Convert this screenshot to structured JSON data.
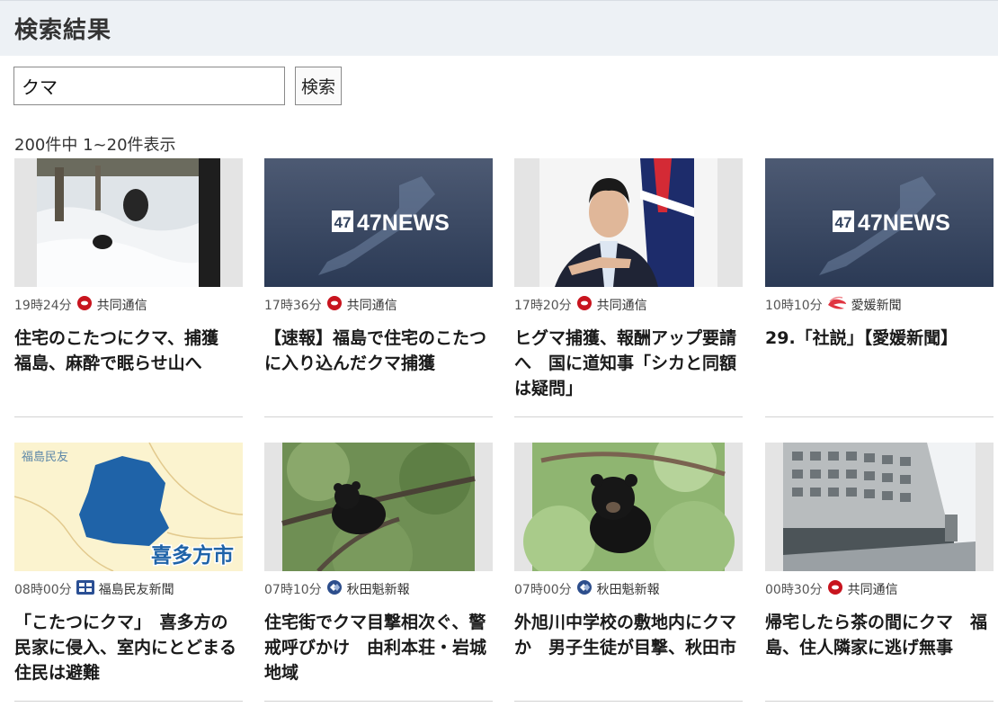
{
  "header": {
    "title": "検索結果"
  },
  "search": {
    "value": "クマ",
    "button_label": "検索"
  },
  "results_count": "200件中 1~20件表示",
  "articles": [
    {
      "time": "19時24分",
      "source": "共同通信",
      "logo": "kyodo-logo",
      "title": "住宅のこたつにクマ、捕獲　福島、麻酔で眠らせ山へ",
      "image": "bear-in-snow"
    },
    {
      "time": "17時36分",
      "source": "共同通信",
      "logo": "kyodo-logo",
      "title": "【速報】福島で住宅のこたつに入り込んだクマ捕獲",
      "image": "47news-placeholder",
      "image_text": "47NEWS"
    },
    {
      "time": "17時20分",
      "source": "共同通信",
      "logo": "kyodo-logo",
      "title": "ヒグマ捕獲、報酬アップ要請へ　国に道知事「シカと同額は疑問」",
      "image": "governor-speaking"
    },
    {
      "time": "10時10分",
      "source": "愛媛新聞",
      "logo": "ehime-logo",
      "title": "29.「社説」【愛媛新聞】",
      "image": "47news-placeholder",
      "image_text": "47NEWS"
    },
    {
      "time": "08時00分",
      "source": "福島民友新聞",
      "logo": "minyu-logo",
      "title": "「こたつにクマ」　喜多方の民家に侵入、室内にとどまる　住民は避難",
      "image": "map-kitakata",
      "image_text": "喜多方市",
      "image_corner_text": "福島民友"
    },
    {
      "time": "07時10分",
      "source": "秋田魁新報",
      "logo": "sakigake-logo",
      "title": "住宅街でクマ目撃相次ぐ、警戒呼びかけ　由利本荘・岩城地域",
      "image": "bear-in-tree"
    },
    {
      "time": "07時00分",
      "source": "秋田魁新報",
      "logo": "sakigake-logo",
      "title": "外旭川中学校の敷地内にクマか　男子生徒が目撃、秋田市",
      "image": "bear-in-leaves"
    },
    {
      "time": "00時30分",
      "source": "共同通信",
      "logo": "kyodo-logo",
      "title": "帰宅したら茶の間にクマ　福島、住人隣家に逃げ無事",
      "image": "office-building"
    }
  ]
}
